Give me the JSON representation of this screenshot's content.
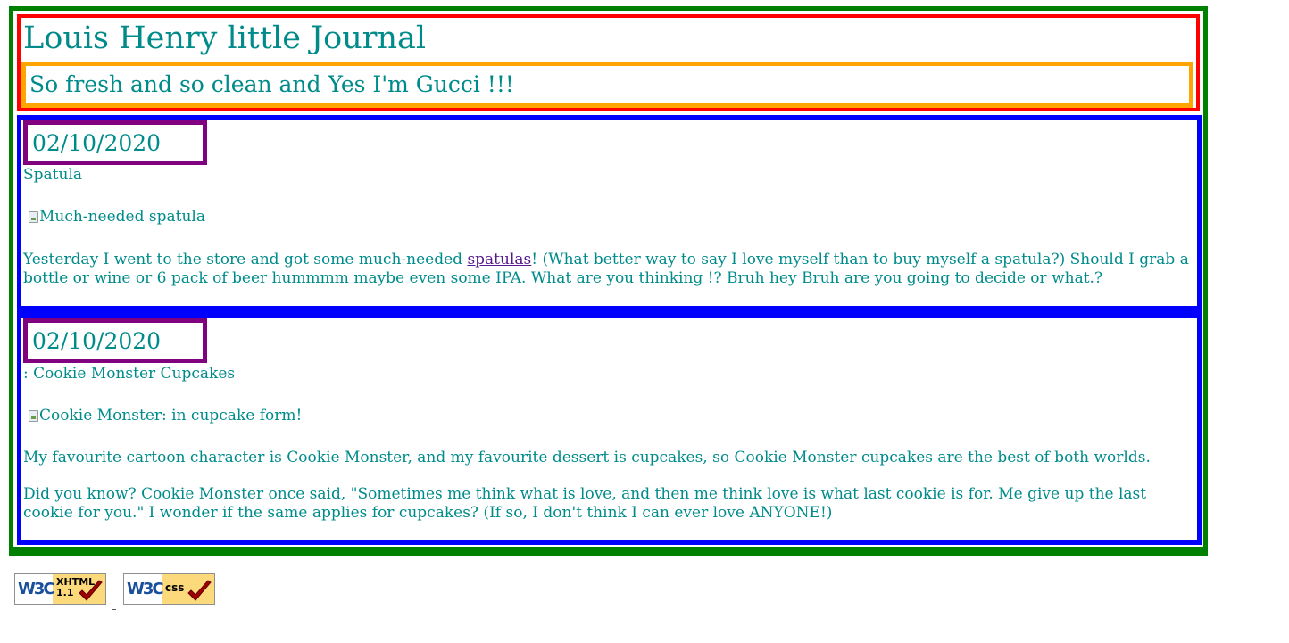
{
  "header": {
    "title": "Louis Henry little Journal",
    "tagline": "So fresh and so clean and Yes I'm Gucci !!!"
  },
  "posts": [
    {
      "date": "02/10/2020",
      "title": "Spatula",
      "image_alt": "Much-needed spatula",
      "paragraphs": [
        {
          "before_link": "Yesterday I went to the store and got some much-needed ",
          "link_text": "spatulas",
          "after_link": "! (What better way to say I love myself than to buy myself a spatula?) Should I grab a bottle or wine or 6 pack of beer hummmm maybe even some IPA. What are you thinking !? Bruh hey Bruh are you going to decide or what.?"
        }
      ]
    },
    {
      "date": "02/10/2020",
      "title": ": Cookie Monster Cupcakes",
      "image_alt": "Cookie Monster: in cupcake form!",
      "paragraphs": [
        "My favourite cartoon character is Cookie Monster, and my favourite dessert is cupcakes, so Cookie Monster cupcakes are the best of both worlds.",
        "Did you know? Cookie Monster once said, \"Sometimes me think what is love, and then me think love is what last cookie is for. Me give up the last cookie for you.\" I wonder if the same applies for cupcakes? (If so, I don't think I can ever love ANYONE!)"
      ]
    }
  ],
  "badges": {
    "xhtml": {
      "logo": "W3C",
      "line1": "XHTML",
      "line2": "1.1",
      "icon": "checkmark-icon"
    },
    "css": {
      "logo": "W3C",
      "line1": "css",
      "line2": "",
      "icon": "checkmark-icon"
    }
  },
  "colors": {
    "text": "#008b8b",
    "outer_border": "#008000",
    "header_border": "#ff0000",
    "tagline_border": "#ffa500",
    "post_border": "#0000ff",
    "date_border": "#800080",
    "link": "#551a8b"
  }
}
